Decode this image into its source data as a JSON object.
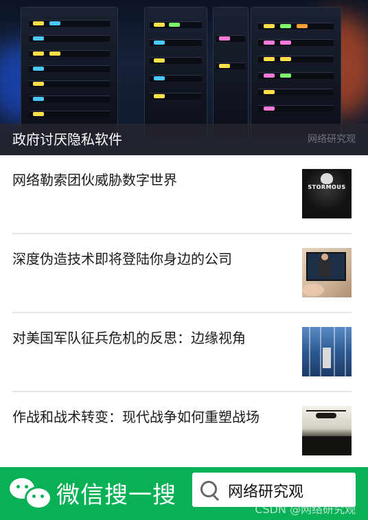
{
  "hero": {
    "title": "政府讨厌隐私软件",
    "watermark": "网络研究观"
  },
  "articles": [
    {
      "title": "网络勒索团伙威胁数字世界",
      "thumb_text": "STORMOUS"
    },
    {
      "title": "深度伪造技术即将登陆你身边的公司"
    },
    {
      "title": "对美国军队征兵危机的反思：边缘视角"
    },
    {
      "title": "作战和战术转变：现代战争如何重塑战场"
    }
  ],
  "banner": {
    "label": "微信搜一搜",
    "search_term": "网络研究观",
    "credit": "CSDN @网络研究观",
    "color": "#08b056"
  }
}
